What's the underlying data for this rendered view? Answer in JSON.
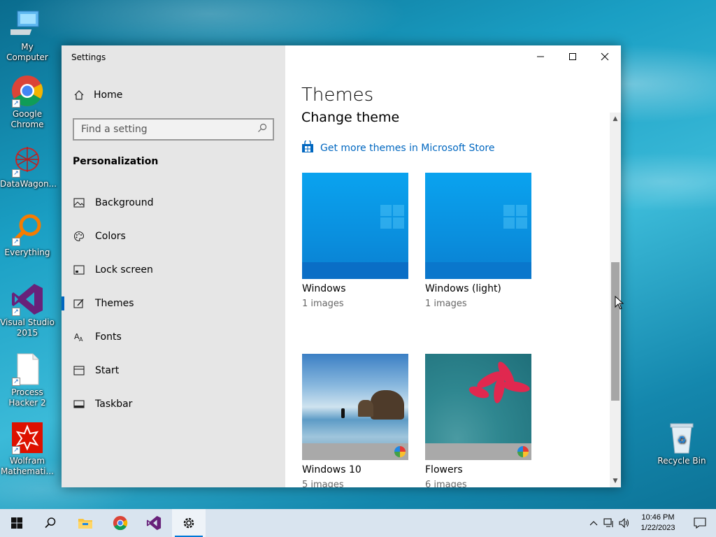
{
  "desktop": {
    "icons": [
      {
        "label": "My Computer",
        "icon": "computer-icon"
      },
      {
        "label": "Google Chrome",
        "icon": "chrome-icon"
      },
      {
        "label": "DataWagon...",
        "icon": "datawagon-icon"
      },
      {
        "label": "Everything",
        "icon": "everything-search-icon"
      },
      {
        "label": "Visual Studio 2015",
        "icon": "visual-studio-icon"
      },
      {
        "label": "Process Hacker 2",
        "icon": "document-icon"
      },
      {
        "label": "Wolfram Mathemati...",
        "icon": "wolfram-icon"
      },
      {
        "label": "Recycle Bin",
        "icon": "recycle-bin-icon"
      }
    ]
  },
  "window": {
    "title": "Settings",
    "controls": {
      "minimize": "—",
      "maximize": "☐",
      "close": "✕"
    }
  },
  "sidebar": {
    "home_label": "Home",
    "search_placeholder": "Find a setting",
    "section_heading": "Personalization",
    "items": [
      {
        "label": "Background",
        "icon": "image-icon"
      },
      {
        "label": "Colors",
        "icon": "palette-icon"
      },
      {
        "label": "Lock screen",
        "icon": "lock-screen-icon"
      },
      {
        "label": "Themes",
        "icon": "themes-icon",
        "active": true
      },
      {
        "label": "Fonts",
        "icon": "fonts-icon"
      },
      {
        "label": "Start",
        "icon": "start-icon"
      },
      {
        "label": "Taskbar",
        "icon": "taskbar-icon"
      }
    ]
  },
  "main": {
    "title": "Themes",
    "subtitle": "Change theme",
    "store_link": "Get more themes in Microsoft Store",
    "themes": [
      {
        "name": "Windows",
        "count": "1 images"
      },
      {
        "name": "Windows (light)",
        "count": "1 images"
      },
      {
        "name": "Windows 10",
        "count": "5 images"
      },
      {
        "name": "Flowers",
        "count": "6 images"
      }
    ]
  },
  "taskbar": {
    "apps": [
      "start-icon",
      "search-icon",
      "file-explorer-icon",
      "chrome-icon",
      "visual-studio-icon",
      "settings-icon"
    ],
    "time": "10:46 PM",
    "date": "1/22/2023"
  },
  "colors": {
    "accent": "#0067c0",
    "sidebar_bg": "#e6e6e6",
    "taskbar_bg": "#d9e4ef"
  }
}
